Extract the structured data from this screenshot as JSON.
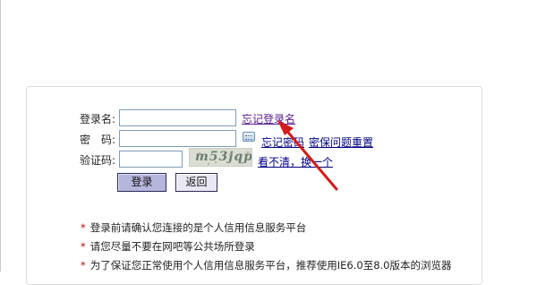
{
  "form": {
    "username_label": "登录名:",
    "password_label": "密　码:",
    "captcha_label": "验证码:",
    "username_value": "",
    "password_value": "",
    "captcha_value": "",
    "captcha_image_text": "m53jqp"
  },
  "links": {
    "forgot_username": "忘记登录名",
    "forgot_password": "忘记密码",
    "security_question_reset": "密保问题重置",
    "refresh_captcha": "看不清，换一个"
  },
  "buttons": {
    "login": "登录",
    "back": "返回"
  },
  "notes": [
    "登录前请确认您连接的是个人信用信息服务平台",
    "请您尽量不要在网吧等公共场所登录",
    "为了保证您正常使用个人信用信息服务平台，推荐使用IE6.0至8.0版本的浏览器"
  ],
  "icons": {
    "keyboard": "soft-keyboard-icon",
    "annotation_arrow": "red-arrow"
  },
  "colors": {
    "link": "#000080",
    "visited_link": "#551a8b",
    "required_star": "#c00000",
    "arrow": "#d21b1b",
    "login_button_bg": "#b6b5dc"
  }
}
